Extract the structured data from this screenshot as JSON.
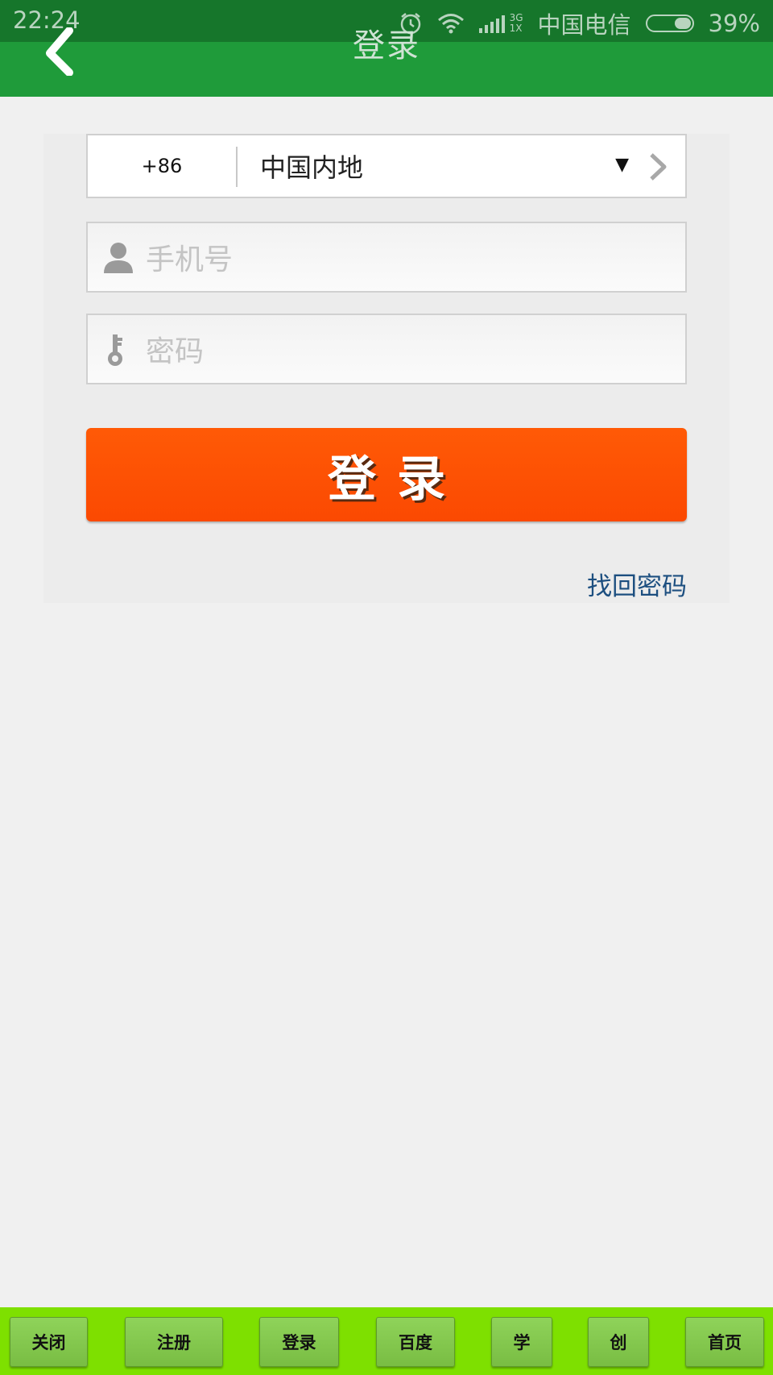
{
  "status_bar": {
    "time": "22:24",
    "carrier": "中国电信",
    "battery_percent": "39%",
    "battery_level": 0.39,
    "network_label_top": "3G",
    "network_label_bottom": "1X",
    "icons": [
      "alarm-icon",
      "wifi-icon",
      "signal-icon",
      "battery-icon"
    ]
  },
  "header": {
    "title": "登录",
    "back_icon": "chevron-left-icon",
    "color": "#1f9b3a"
  },
  "form": {
    "dial_code": "+86",
    "country": "中国内地",
    "dropdown_glyph": "▼",
    "phone_placeholder": "手机号",
    "password_placeholder": "密码",
    "login_label": "登录",
    "forgot_password": "找回密码",
    "login_button_color": "#fb4e02",
    "link_color": "#1d4f80"
  },
  "toolbar": {
    "items": [
      {
        "label": "关闭"
      },
      {
        "label": "注册"
      },
      {
        "label": "登录"
      },
      {
        "label": "百度"
      },
      {
        "label": "学"
      },
      {
        "label": "创"
      },
      {
        "label": "首页"
      }
    ],
    "background": "#7ee000"
  }
}
